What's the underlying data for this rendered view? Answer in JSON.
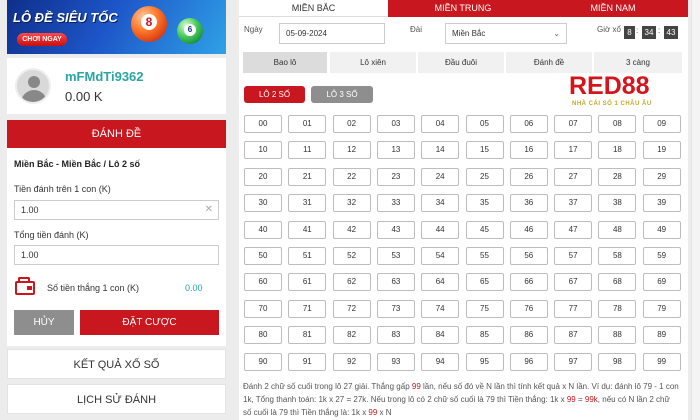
{
  "banner": {
    "title": "LÔ ĐỀ SIÊU TỐC",
    "cta": "CHƠI NGAY",
    "ball1": "8",
    "ball2": "6"
  },
  "user": {
    "name": "mFMdTi9362",
    "balance": "0.00 K"
  },
  "form": {
    "header": "ĐÁNH ĐỀ",
    "breadcrumb": "Miền Bắc - Miền Bắc / Lô 2 số",
    "stake_label": "Tiền đánh trên 1 con (K)",
    "stake_value": "1.00",
    "clear_icon": "close-icon",
    "total_label": "Tổng tiền đánh (K)",
    "total_value": "1.00",
    "win_label": "Số tiền thắng 1 con (K)",
    "win_value": "0.00",
    "cancel": "HỦY",
    "bet": "ĐẶT CƯỢC"
  },
  "nav": {
    "results": "KẾT QUẢ XỔ SỐ",
    "history": "LỊCH SỬ ĐÁNH"
  },
  "regions": [
    "MIỀN BẮC",
    "MIỀN TRUNG",
    "MIỀN NAM"
  ],
  "filters": {
    "date_label": "Ngày",
    "date_value": "05-09-2024",
    "station_label": "Đài",
    "station_value": "Miền Bắc",
    "draw_time_label": "Giờ xổ",
    "hh": "8",
    "mm": "34",
    "ss": "43"
  },
  "bet_types": [
    "Bao lô",
    "Lô xiên",
    "Đầu đuôi",
    "Đánh đề",
    "3 càng"
  ],
  "sub_types": [
    "LÔ 2 SỐ",
    "LÔ 3 SỐ"
  ],
  "logo": {
    "brand": "RED88",
    "tagline": "NHÀ CÁI SỐ 1 CHÂU ÂU"
  },
  "numbers": [
    "00",
    "01",
    "02",
    "03",
    "04",
    "05",
    "06",
    "07",
    "08",
    "09",
    "10",
    "11",
    "12",
    "13",
    "14",
    "15",
    "16",
    "17",
    "18",
    "19",
    "20",
    "21",
    "22",
    "23",
    "24",
    "25",
    "26",
    "27",
    "28",
    "29",
    "30",
    "31",
    "32",
    "33",
    "34",
    "35",
    "36",
    "37",
    "38",
    "39",
    "40",
    "41",
    "42",
    "43",
    "44",
    "45",
    "46",
    "47",
    "48",
    "49",
    "50",
    "51",
    "52",
    "53",
    "54",
    "55",
    "56",
    "57",
    "58",
    "59",
    "60",
    "61",
    "62",
    "63",
    "64",
    "65",
    "66",
    "67",
    "68",
    "69",
    "70",
    "71",
    "72",
    "73",
    "74",
    "75",
    "76",
    "77",
    "78",
    "79",
    "80",
    "81",
    "82",
    "83",
    "84",
    "85",
    "86",
    "87",
    "88",
    "89",
    "90",
    "91",
    "92",
    "93",
    "94",
    "95",
    "96",
    "97",
    "98",
    "99"
  ],
  "note": {
    "p1": "Đánh 2 chữ số cuối trong lô 27 giải. Thắng gấp ",
    "h1": "99",
    "p2": " lần, nếu số đó về N lần thì tính kết quả x N lần. Ví dụ: đánh lô 79 - 1 con 1k, Tổng thanh toán: 1k x 27 = 27k. Nếu trong lô có 2 chữ số cuối là 79 thì Tiền thắng: 1k x ",
    "h2": "99",
    "p3": " = ",
    "h3": "99k",
    "p4": ", nếu có N lần 2 chữ số cuối là 79 thì Tiền thắng là: 1k x ",
    "h4": "99",
    "p5": " x N"
  },
  "colors": {
    "accent": "#c8171e",
    "teal": "#2aa5a5"
  }
}
